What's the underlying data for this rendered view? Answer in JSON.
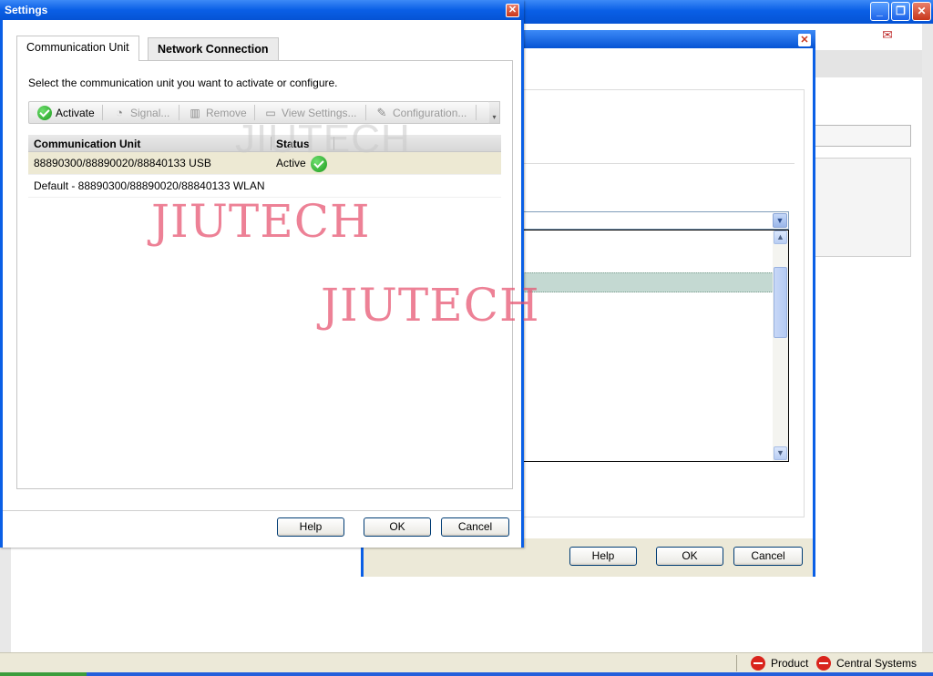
{
  "settings_dialog": {
    "title": "Settings",
    "close_glyph": "✕",
    "tabs": [
      {
        "label": "Communication Unit",
        "active": true
      },
      {
        "label": "Network Connection",
        "active": false
      }
    ],
    "instruction": "Select the communication unit you want to activate or configure.",
    "toolbar": {
      "activate": "Activate",
      "signal": "Signal...",
      "remove": "Remove",
      "view_settings": "View Settings...",
      "configuration": "Configuration...",
      "overflow_glyph": "▾"
    },
    "table": {
      "headers": [
        "Communication Unit",
        "Status"
      ],
      "rows": [
        {
          "unit": "88890300/88890020/88840133 USB",
          "status": "Active",
          "selected": true
        },
        {
          "unit": "Default - 88890300/88890020/88840133 WLAN",
          "status": "",
          "selected": false
        }
      ]
    },
    "buttons": {
      "help": "Help",
      "ok": "OK",
      "cancel": "Cancel"
    }
  },
  "second_dialog": {
    "close_glyph": "✕",
    "buttons": {
      "help": "Help",
      "ok": "OK",
      "cancel": "Cancel"
    }
  },
  "window_controls": {
    "minimize": "_",
    "maximize": "❐",
    "close": "✕"
  },
  "statusbar": {
    "product": "Product",
    "central_systems": "Central Systems"
  },
  "watermarks": [
    "JIUTECH",
    "JIUTECH",
    "JIUTECH"
  ],
  "colors": {
    "titlebar": "#0a5fe6",
    "selected_row": "#ede9d3",
    "active_check": "#1d9a1d",
    "stop_icon": "#d9241c",
    "watermark": "#e6506e"
  }
}
